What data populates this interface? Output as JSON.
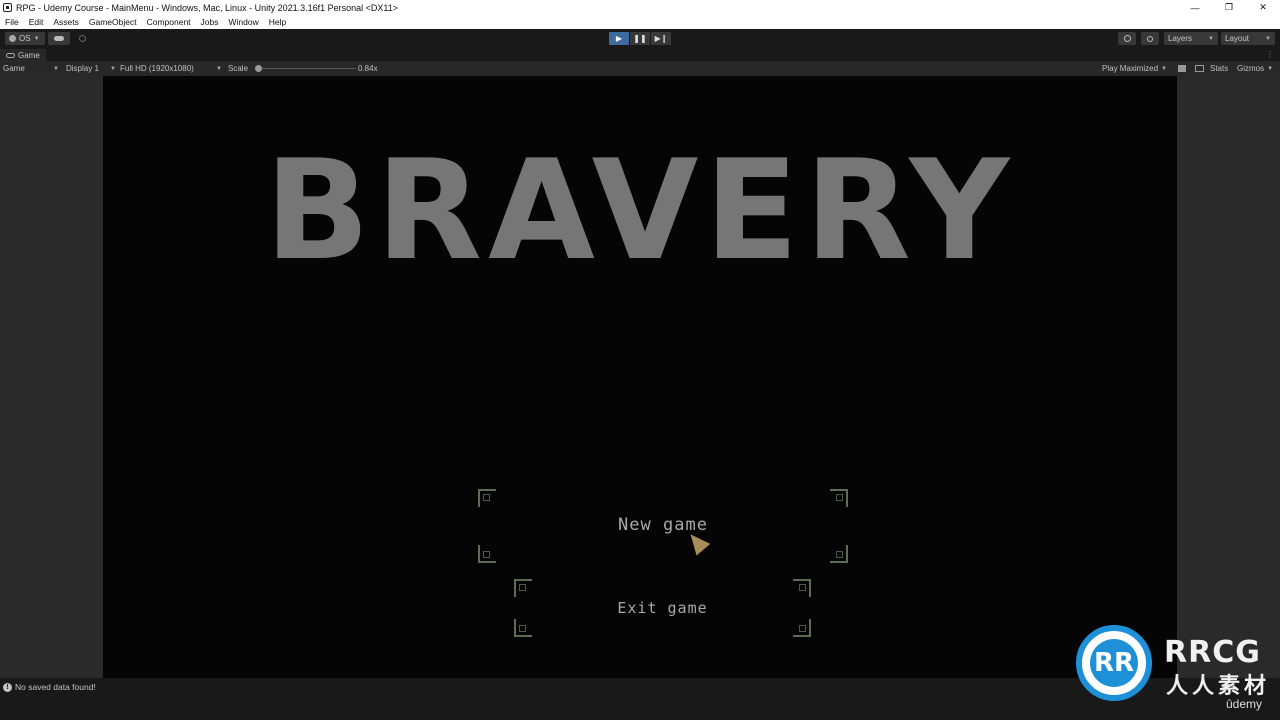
{
  "window": {
    "title": "RPG - Udemy Course - MainMenu - Windows, Mac, Linux - Unity 2021.3.16f1 Personal <DX11>",
    "controls": [
      "—",
      "❐",
      "✕"
    ]
  },
  "menubar": {
    "items": [
      "File",
      "Edit",
      "Assets",
      "GameObject",
      "Component",
      "Jobs",
      "Window",
      "Help"
    ]
  },
  "toolbar": {
    "account_label": "OS",
    "layers_label": "Layers",
    "layout_label": "Layout",
    "play_state": "playing"
  },
  "tab": {
    "label": "Game"
  },
  "game_toolbar": {
    "view_mode": "Game",
    "display": "Display 1",
    "resolution": "Full HD (1920x1080)",
    "scale_label": "Scale",
    "scale_value": "0.84x",
    "play_mode": "Play Maximized",
    "stats_label": "Stats",
    "gizmos_label": "Gizmos"
  },
  "game": {
    "title": "BRAVERY",
    "buttons": [
      {
        "label": "New game"
      },
      {
        "label": "Exit game"
      }
    ]
  },
  "status": {
    "message": "No saved data found!"
  },
  "watermark": {
    "logo_text": "RR",
    "name": "RRCG",
    "sub": "人人素材",
    "brand": "ûdemy"
  },
  "colors": {
    "accent": "#3d6ba0",
    "title_gray": "#767676",
    "frame_green": "#5e6b55",
    "watermark_blue": "#1e90d8"
  }
}
